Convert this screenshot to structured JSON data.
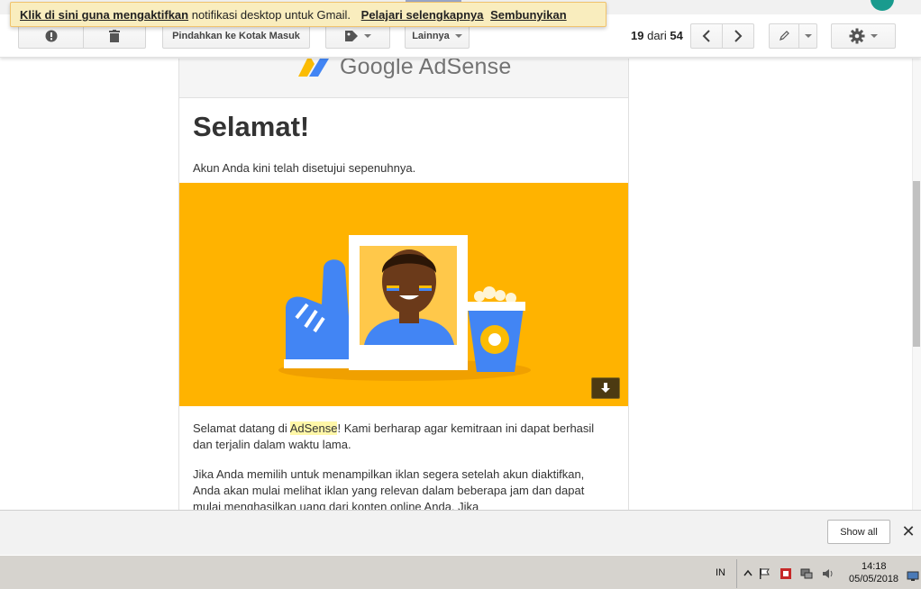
{
  "notification": {
    "enable_link": "Klik di sini guna mengaktifkan",
    "message": "notifikasi desktop untuk Gmail.",
    "learn_more": "Pelajari selengkapnya",
    "hide": "Sembunyikan"
  },
  "toolbar": {
    "move_to_inbox": "Pindahkan ke Kotak Masuk",
    "more": "Lainnya",
    "pager_current": "19",
    "pager_of": "dari",
    "pager_total": "54",
    "icons": [
      "report-spam-icon",
      "delete-icon",
      "label-icon",
      "prev-icon",
      "next-icon",
      "pencil-icon",
      "gear-icon"
    ]
  },
  "email": {
    "logo_text": "Google AdSense",
    "heading": "Selamat!",
    "subline": "Akun Anda kini telah disetujui sepenuhnya.",
    "para1_before": "Selamat datang di ",
    "para1_highlight": "AdSense",
    "para1_after": "! Kami berharap agar kemitraan ini dapat berhasil dan terjalin dalam waktu lama.",
    "para2": "Jika Anda memilih untuk menampilkan iklan segera setelah akun diaktifkan, Anda akan mulai melihat iklan yang relevan dalam beberapa jam dan dapat mulai menghasilkan uang dari konten online Anda. Jika",
    "hero_color": "#ffb300"
  },
  "shelf": {
    "show_all": "Show all",
    "close": "✕"
  },
  "taskbar": {
    "lang": "IN",
    "time": "14:18",
    "date": "05/05/2018"
  }
}
